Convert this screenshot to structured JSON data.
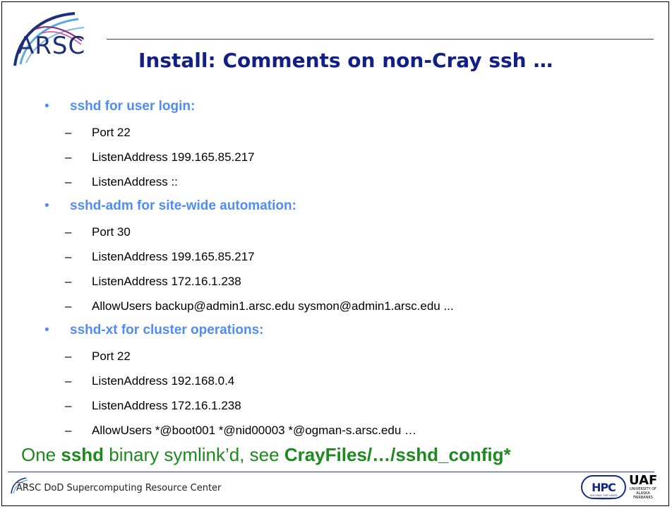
{
  "header": {
    "logo_text": "ARSC",
    "title": "Install: Comments on non-Cray ssh …"
  },
  "sections": [
    {
      "bullet": "sshd for user login:",
      "items": [
        "Port  22",
        "ListenAddress 199.165.85.217",
        "ListenAddress ::"
      ]
    },
    {
      "bullet": "sshd-adm for site-wide automation:",
      "items": [
        "Port  30",
        "ListenAddress 199.165.85.217",
        "ListenAddress 172.16.1.238",
        "AllowUsers backup@admin1.arsc.edu sysmon@admin1.arsc.edu ..."
      ]
    },
    {
      "bullet": "sshd-xt for cluster operations:",
      "items": [
        "Port  22",
        "ListenAddress 192.168.0.4",
        "ListenAddress 172.16.1.238",
        "AllowUsers  *@boot001 *@nid00003 *@ogman-s.arsc.edu …"
      ]
    }
  ],
  "summary": {
    "prefix": "One ",
    "binary": "sshd",
    "middle": " binary symlink’d, see ",
    "path": "CrayFiles/…/sshd_config*"
  },
  "footer": {
    "text": "ARSC DoD Supercomputing Resource Center",
    "hpc_logo_text": "HPC",
    "hpc_tagline": "SOLVING THE HARD PROBLEMS",
    "uaf_logo_text": "UAF",
    "uaf_sub1": "UNIVERSITY OF",
    "uaf_sub2": "ALASKA",
    "uaf_sub3": "FAIRBANKS"
  },
  "glyphs": {
    "bullet": "•",
    "dash": "–"
  },
  "colors": {
    "title": "#121f85",
    "bullet": "#4f8df4",
    "summary": "#1c8a1c",
    "rule": "#2b3a8c"
  }
}
